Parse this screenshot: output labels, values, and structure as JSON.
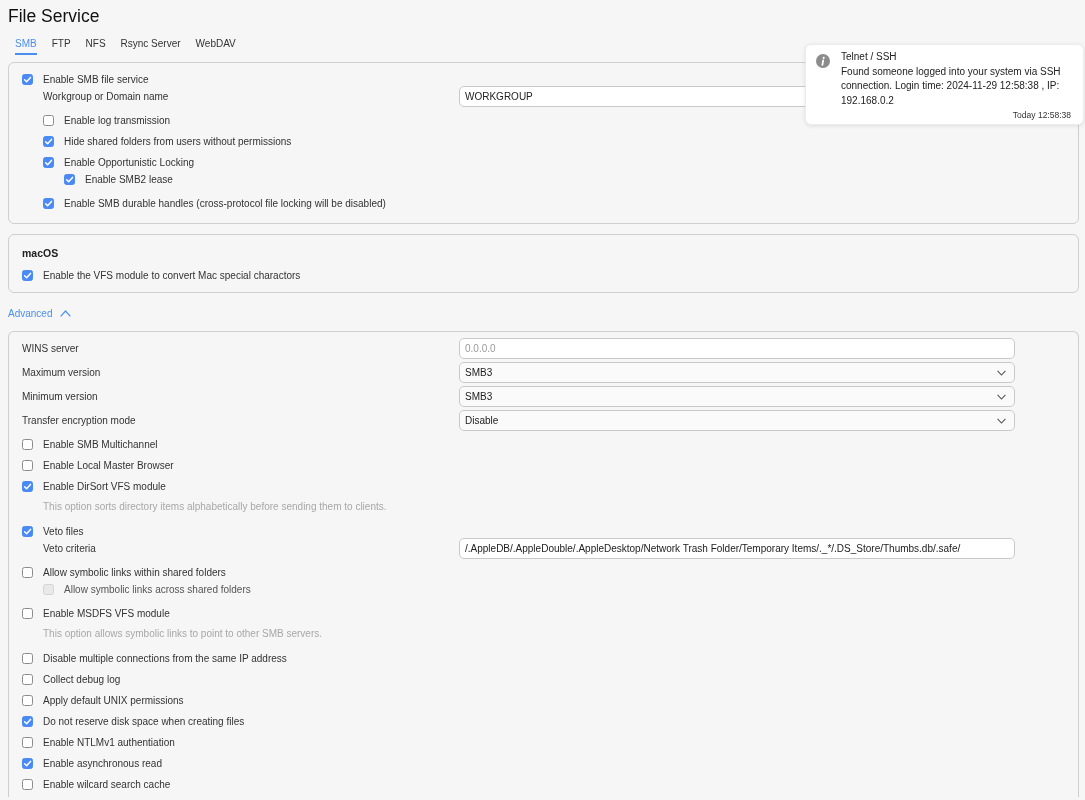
{
  "page": {
    "title": "File Service"
  },
  "tabs": [
    {
      "label": "SMB",
      "selected": true
    },
    {
      "label": "FTP",
      "selected": false
    },
    {
      "label": "NFS",
      "selected": false
    },
    {
      "label": "Rsync Server",
      "selected": false
    },
    {
      "label": "WebDAV",
      "selected": false
    }
  ],
  "general": {
    "rows": [
      {
        "kind": "checkbox",
        "label": "Enable SMB file service",
        "checked": true,
        "children": [
          {
            "kind": "input",
            "label": "Workgroup or Domain name",
            "value": "WORKGROUP"
          },
          {
            "kind": "checkbox",
            "label": "Enable log transmission",
            "checked": false
          },
          {
            "kind": "checkbox",
            "label": "Hide shared folders from users without permissions",
            "checked": true
          },
          {
            "kind": "checkbox",
            "label": "Enable Opportunistic Locking",
            "checked": true,
            "children": [
              {
                "kind": "checkbox",
                "label": "Enable SMB2 lease",
                "checked": true
              }
            ]
          },
          {
            "kind": "checkbox",
            "label": "Enable SMB durable handles (cross-protocol file locking will be disabled)",
            "checked": true
          }
        ]
      }
    ]
  },
  "macos": {
    "heading": "macOS",
    "rows": [
      {
        "kind": "checkbox",
        "label": "Enable the VFS module to convert Mac special charactors",
        "checked": true
      }
    ]
  },
  "advanced": {
    "label": "Advanced",
    "expanded": true,
    "rows": [
      {
        "kind": "input",
        "label": "WINS server",
        "placeholder": "0.0.0.0"
      },
      {
        "kind": "select",
        "label": "Maximum version",
        "value": "SMB3"
      },
      {
        "kind": "select",
        "label": "Minimum version",
        "value": "SMB3"
      },
      {
        "kind": "select",
        "label": "Transfer encryption mode",
        "value": "Disable"
      },
      {
        "kind": "checkbox",
        "label": "Enable SMB Multichannel",
        "checked": false
      },
      {
        "kind": "checkbox",
        "label": "Enable Local Master Browser",
        "checked": false
      },
      {
        "kind": "checkbox",
        "label": "Enable DirSort VFS module",
        "checked": true,
        "hint": "This option sorts directory items alphabetically before sending them to clients."
      },
      {
        "kind": "checkbox",
        "label": "Veto files",
        "checked": true,
        "children": [
          {
            "kind": "input",
            "label": "Veto criteria",
            "value": "/.AppleDB/.AppleDouble/.AppleDesktop/Network Trash Folder/Temporary Items/._*/.DS_Store/Thumbs.db/.safe/"
          }
        ]
      },
      {
        "kind": "checkbox",
        "label": "Allow symbolic links within shared folders",
        "checked": false,
        "children": [
          {
            "kind": "checkbox",
            "label": "Allow symbolic links across shared folders",
            "checked": false,
            "disabled": true
          }
        ]
      },
      {
        "kind": "checkbox",
        "label": "Enable MSDFS VFS module",
        "checked": false,
        "hint": "This option allows symbolic links to point to other SMB servers."
      },
      {
        "kind": "checkbox",
        "label": "Disable multiple connections from the same IP address",
        "checked": false
      },
      {
        "kind": "checkbox",
        "label": "Collect debug log",
        "checked": false
      },
      {
        "kind": "checkbox",
        "label": "Apply default UNIX permissions",
        "checked": false
      },
      {
        "kind": "checkbox",
        "label": "Do not reserve disk space when creating files",
        "checked": true
      },
      {
        "kind": "checkbox",
        "label": "Enable NTLMv1 authentiation",
        "checked": false
      },
      {
        "kind": "checkbox",
        "label": "Enable asynchronous read",
        "checked": true
      },
      {
        "kind": "checkbox",
        "label": "Enable wilcard search cache",
        "checked": false
      }
    ]
  },
  "notification": {
    "title": "Telnet / SSH",
    "message": "Found someone logged into your system via SSH connection. Login time: 2024-11-29 12:58:38 , IP: 192.168.0.2",
    "time": "Today 12:58:38"
  }
}
